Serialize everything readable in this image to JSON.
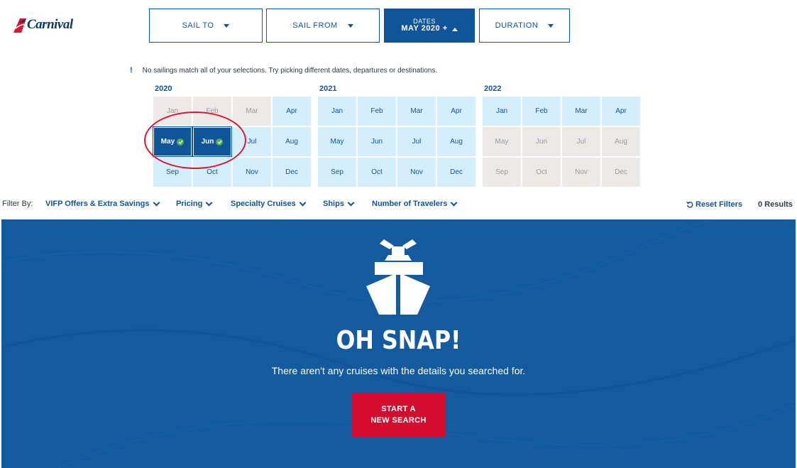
{
  "brand": {
    "name": "Carnival"
  },
  "nav": {
    "sail_to": "SAIL TO",
    "sail_from": "SAIL FROM",
    "dates_label": "DATES",
    "dates_value": "MAY 2020 +",
    "duration": "DURATION"
  },
  "notice": {
    "icon": "!",
    "text": "No sailings match all of your selections. Try picking different dates, departures or destinations."
  },
  "calendar": {
    "years": [
      {
        "year": "2020",
        "months": [
          "Jan",
          "Feb",
          "Mar",
          "Apr",
          "May",
          "Jun",
          "Jul",
          "Aug",
          "Sep",
          "Oct",
          "Nov",
          "Dec"
        ]
      },
      {
        "year": "2021",
        "months": [
          "Jan",
          "Feb",
          "Mar",
          "Apr",
          "May",
          "Jun",
          "Jul",
          "Aug",
          "Sep",
          "Oct",
          "Nov",
          "Dec"
        ]
      },
      {
        "year": "2022",
        "months": [
          "Jan",
          "Feb",
          "Mar",
          "Apr",
          "May",
          "Jun",
          "Jul",
          "Aug",
          "Sep",
          "Oct",
          "Nov",
          "Dec"
        ]
      }
    ]
  },
  "filters": {
    "label": "Filter By:",
    "items": [
      "VIFP Offers & Extra Savings",
      "Pricing",
      "Specialty Cruises",
      "Ships",
      "Number of Travelers"
    ],
    "reset": "Reset Filters",
    "results": "0 Results"
  },
  "hero": {
    "title": "OH SNAP!",
    "subtitle": "There aren't any cruises with the details you searched for.",
    "cta_line1": "START A",
    "cta_line2": "NEW SEARCH"
  },
  "colors": {
    "brand_blue": "#10559a",
    "cta_red": "#d40d2e",
    "available": "#d4eefb",
    "disabled": "#ece9e8",
    "check_green": "#4caf50"
  }
}
